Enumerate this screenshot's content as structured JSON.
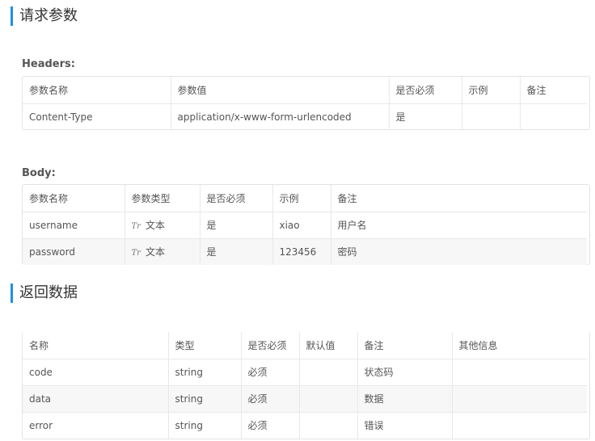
{
  "request_section": {
    "title": "请求参数",
    "headers": {
      "label": "Headers:",
      "columns": [
        "参数名称",
        "参数值",
        "是否必须",
        "示例",
        "备注"
      ],
      "rows": [
        [
          "Content-Type",
          "application/x-www-form-urlencoded",
          "是",
          "",
          ""
        ]
      ]
    },
    "body": {
      "label": "Body:",
      "columns": [
        "参数名称",
        "参数类型",
        "是否必须",
        "示例",
        "备注"
      ],
      "rows": [
        {
          "name": "username",
          "type_icon": "Tr",
          "type": "文本",
          "required": "是",
          "example": "xiao",
          "note": "用户名"
        },
        {
          "name": "password",
          "type_icon": "Tr",
          "type": "文本",
          "required": "是",
          "example": "123456",
          "note": "密码"
        }
      ]
    }
  },
  "response_section": {
    "title": "返回数据",
    "columns": [
      "名称",
      "类型",
      "是否必须",
      "默认值",
      "备注",
      "其他信息"
    ],
    "rows": [
      [
        "code",
        "string",
        "必须",
        "",
        "状态码",
        ""
      ],
      [
        "data",
        "string",
        "必须",
        "",
        "数据",
        ""
      ],
      [
        "error",
        "string",
        "必须",
        "",
        "错误",
        ""
      ]
    ]
  },
  "colors": {
    "accent": "#1e90e6",
    "border": "#e8e8e8",
    "alt_row": "#f7f7f7"
  }
}
